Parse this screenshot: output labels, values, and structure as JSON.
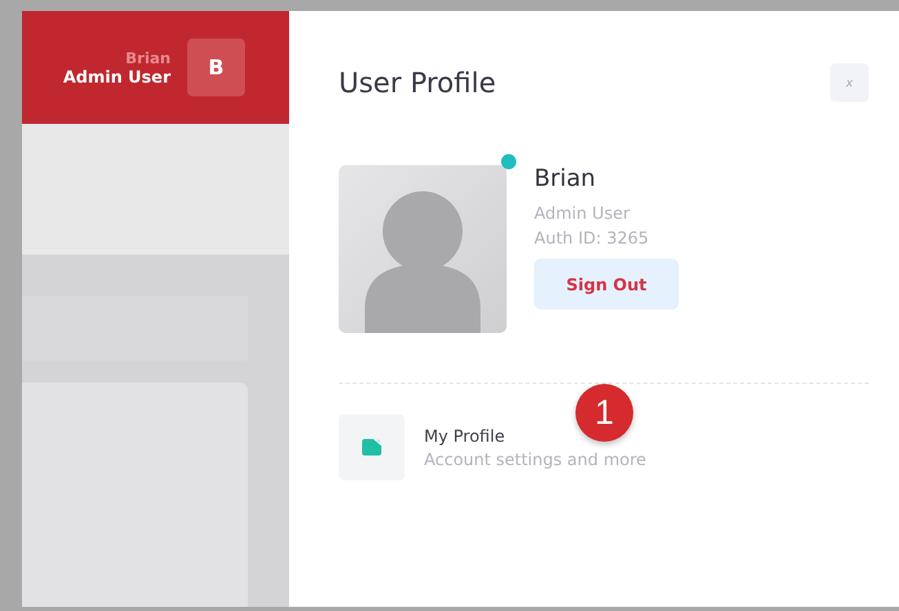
{
  "header": {
    "name": "Brian",
    "role": "Admin User",
    "avatar_letter": "B"
  },
  "panel": {
    "title": "User Profile",
    "close": "x",
    "user": {
      "name": "Brian",
      "role": "Admin User",
      "auth": "Auth ID: 3265",
      "online": true,
      "sign_out": "Sign Out"
    },
    "menu": [
      {
        "title": "My Profile",
        "subtitle": "Account settings and more",
        "badge": "1"
      }
    ]
  }
}
